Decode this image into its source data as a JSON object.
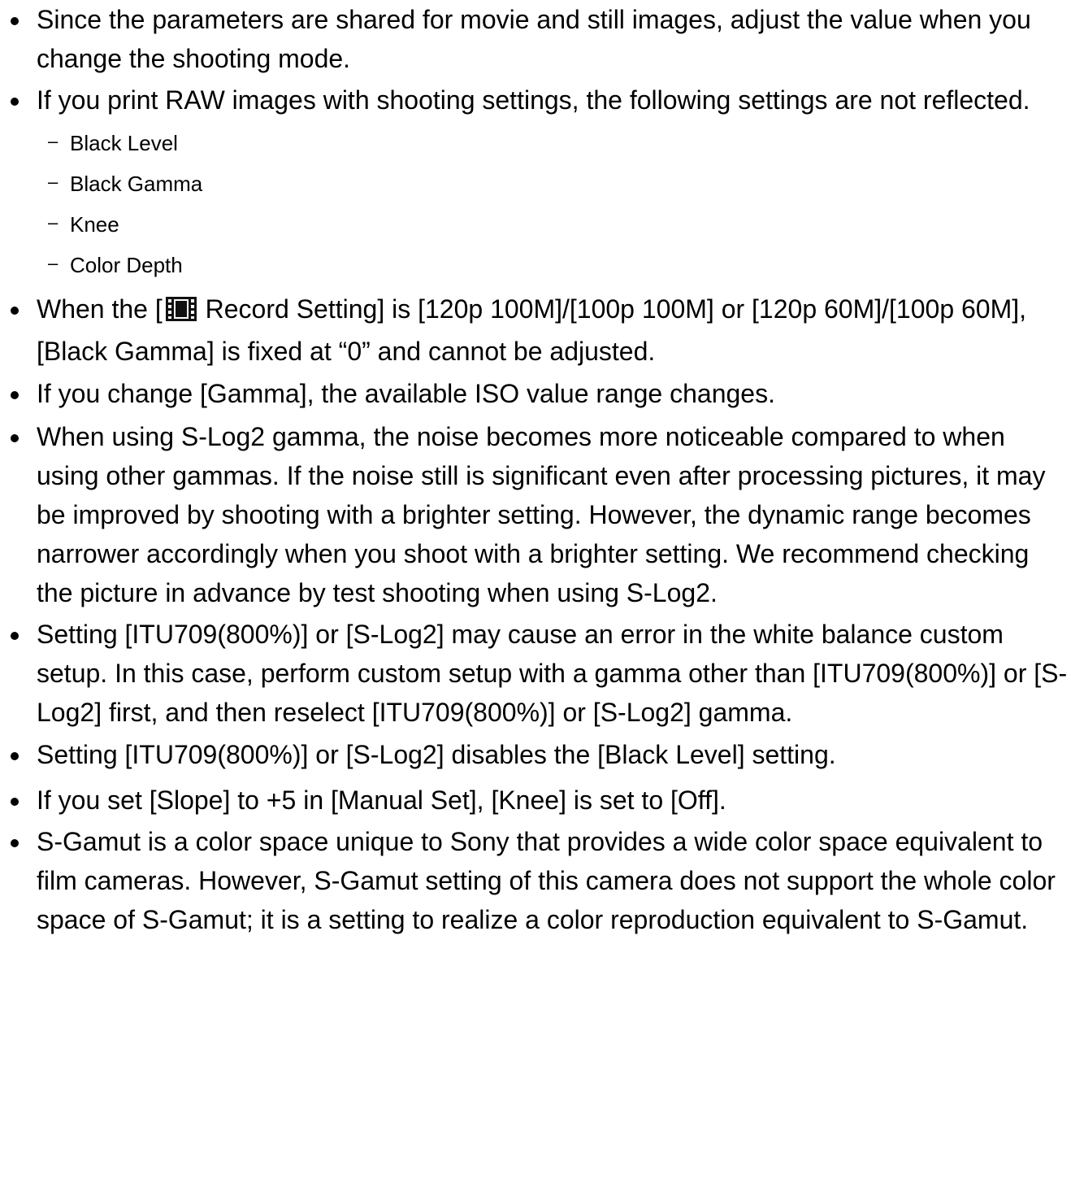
{
  "notes": [
    {
      "text": "Since the parameters are shared for movie and still images, adjust the value when you change the shooting mode."
    },
    {
      "text": "If you print RAW images with shooting settings, the following settings are not reflected.",
      "sub_items": [
        "Black Level",
        "Black Gamma",
        "Knee",
        "Color Depth"
      ]
    },
    {
      "text_before": "When the [",
      "icon": "movie-film-icon",
      "text_after": " Record Setting] is [120p 100M]/[100p 100M] or [120p 60M]/[100p 60M], [Black Gamma] is fixed at “0” and cannot be adjusted."
    },
    {
      "text": "If you change [Gamma], the available ISO value range changes."
    },
    {
      "text": "When using S-Log2 gamma, the noise becomes more noticeable compared to when using other gammas. If the noise still is significant even after processing pictures, it may be improved by shooting with a brighter setting. However, the dynamic range becomes narrower accordingly when you shoot with a brighter setting. We recommend checking the picture in advance by test shooting when using S-Log2."
    },
    {
      "text": "Setting [ITU709(800%)] or [S-Log2] may cause an error in the white balance custom setup. In this case, perform custom setup with a gamma other than [ITU709(800%)] or [S-Log2] first, and then reselect [ITU709(800%)] or [S-Log2] gamma."
    },
    {
      "text": "Setting [ITU709(800%)] or [S-Log2] disables the [Black Level] setting."
    },
    {
      "text": "If you set [Slope] to +5 in [Manual Set], [Knee] is set to [Off]."
    },
    {
      "text": "S-Gamut is a color space unique to Sony that provides a wide color space equivalent to film cameras. However, S-Gamut setting of this camera does not support the whole color space of S-Gamut; it is a setting to realize a color reproduction equivalent to S-Gamut."
    }
  ],
  "sub_item_marker": "–"
}
